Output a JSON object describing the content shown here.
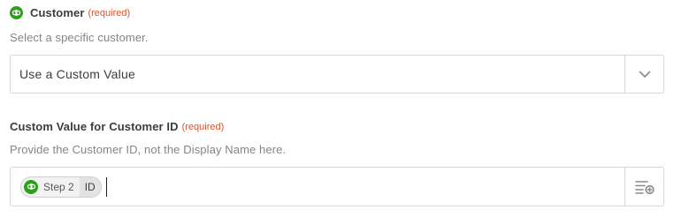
{
  "customer_field": {
    "label": "Customer",
    "required": "(required)",
    "help": "Select a specific customer.",
    "selected_value": "Use a Custom Value",
    "app_icon": "quickbooks-icon",
    "toggle_icon": "chevron-down-icon"
  },
  "custom_id_field": {
    "label": "Custom Value for Customer ID",
    "required": "(required)",
    "help": "Provide the Customer ID, not the Display Name here.",
    "token": {
      "app_icon": "quickbooks-icon",
      "step": "Step 2",
      "field": "ID"
    },
    "insert_icon": "insert-data-icon"
  },
  "colors": {
    "quickbooks_green": "#2ca01c",
    "required_orange": "#d8542e",
    "border": "#d6d6d6",
    "help_text": "#858585"
  }
}
